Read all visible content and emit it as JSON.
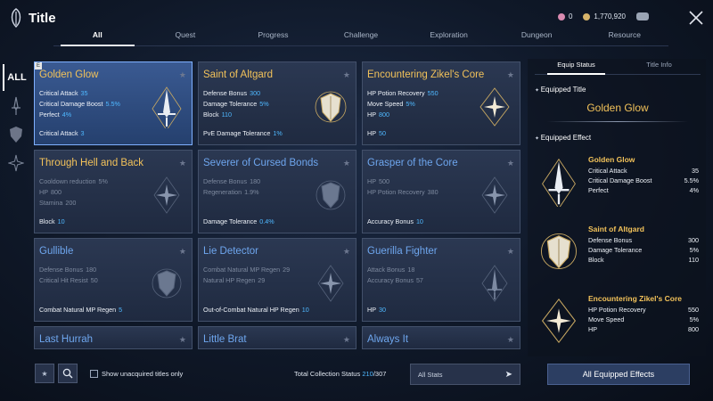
{
  "header": {
    "title": "Title",
    "currency1": "0",
    "currency2": "1,770,920"
  },
  "tabs": [
    "All",
    "Quest",
    "Progress",
    "Challenge",
    "Exploration",
    "Dungeon",
    "Resource"
  ],
  "rail": {
    "all": "ALL"
  },
  "cards": [
    {
      "title": "Golden Glow",
      "color": "gold",
      "selected": true,
      "new": "E",
      "stats": [
        {
          "k": "Critical Attack",
          "v": "35"
        },
        {
          "k": "Critical Damage Boost",
          "v": "5.5%"
        },
        {
          "k": "Perfect",
          "v": "4%"
        }
      ],
      "bottom": {
        "k": "Critical Attack",
        "v": "3"
      }
    },
    {
      "title": "Saint of Altgard",
      "color": "gold",
      "stats": [
        {
          "k": "Defense Bonus",
          "v": "300"
        },
        {
          "k": "Damage Tolerance",
          "v": "5%"
        },
        {
          "k": "Block",
          "v": "110"
        }
      ],
      "bottom": {
        "k": "PvE Damage Tolerance",
        "v": "1%"
      }
    },
    {
      "title": "Encountering Zikel's Core",
      "color": "gold",
      "stats": [
        {
          "k": "HP Potion Recovery",
          "v": "550"
        },
        {
          "k": "Move Speed",
          "v": "5%"
        },
        {
          "k": "HP",
          "v": "800"
        }
      ],
      "bottom": {
        "k": "HP",
        "v": "50"
      }
    },
    {
      "title": "Through Hell and Back",
      "color": "gold",
      "dim": true,
      "stats": [
        {
          "k": "Cooldown reduction",
          "v": "5%"
        },
        {
          "k": "HP",
          "v": "800"
        },
        {
          "k": "Stamina",
          "v": "200"
        }
      ],
      "bottom": {
        "k": "Block",
        "v": "10"
      }
    },
    {
      "title": "Severer of Cursed Bonds",
      "color": "blue",
      "dim": true,
      "stats": [
        {
          "k": "Defense Bonus",
          "v": "180"
        },
        {
          "k": "Regeneration",
          "v": "1.9%"
        }
      ],
      "bottom": {
        "k": "Damage Tolerance",
        "v": "0.4%"
      }
    },
    {
      "title": "Grasper of the Core",
      "color": "blue",
      "dim": true,
      "stats": [
        {
          "k": "HP",
          "v": "500"
        },
        {
          "k": "HP Potion Recovery",
          "v": "380"
        }
      ],
      "bottom": {
        "k": "Accuracy Bonus",
        "v": "10"
      }
    },
    {
      "title": "Gullible",
      "color": "blue",
      "dim": true,
      "stats": [
        {
          "k": "Defense Bonus",
          "v": "180"
        },
        {
          "k": "Critical Hit Resist",
          "v": "50"
        }
      ],
      "bottom": {
        "k": "Combat Natural MP Regen",
        "v": "5"
      }
    },
    {
      "title": "Lie Detector",
      "color": "blue",
      "dim": true,
      "stats": [
        {
          "k": "Combat Natural MP Regen",
          "v": "29"
        },
        {
          "k": "Natural HP Regen",
          "v": "29"
        }
      ],
      "bottom": {
        "k": "Out-of-Combat Natural HP Regen",
        "v": "10"
      }
    },
    {
      "title": "Guerilla Fighter",
      "color": "blue",
      "dim": true,
      "stats": [
        {
          "k": "Attack Bonus",
          "v": "18"
        },
        {
          "k": "Accuracy Bonus",
          "v": "57"
        }
      ],
      "bottom": {
        "k": "HP",
        "v": "30"
      }
    },
    {
      "title": "Last Hurrah",
      "color": "blue",
      "stats": [],
      "bottom": null
    },
    {
      "title": "Little Brat",
      "color": "blue",
      "stats": [],
      "bottom": null
    },
    {
      "title": "Always It",
      "color": "blue",
      "stats": [],
      "bottom": null
    }
  ],
  "bottom": {
    "unacquired": "Show unacquired titles only",
    "total_label": "Total Collection Status",
    "total_have": "210",
    "total_all": "/307",
    "all_stats": "All Stats",
    "all_effects": "All Equipped Effects"
  },
  "panel": {
    "tabs": [
      "Equip Status",
      "Title Info"
    ],
    "equipped_title_h": "Equipped Title",
    "equipped_title": "Golden Glow",
    "equipped_effect_h": "Equipped Effect",
    "effects": [
      {
        "name": "Golden Glow",
        "rows": [
          {
            "k": "Critical Attack",
            "v": "35"
          },
          {
            "k": "Critical Damage Boost",
            "v": "5.5%"
          },
          {
            "k": "Perfect",
            "v": "4%"
          }
        ]
      },
      {
        "name": "Saint of Altgard",
        "rows": [
          {
            "k": "Defense Bonus",
            "v": "300"
          },
          {
            "k": "Damage Tolerance",
            "v": "5%"
          },
          {
            "k": "Block",
            "v": "110"
          }
        ]
      },
      {
        "name": "Encountering Zikel's Core",
        "rows": [
          {
            "k": "HP Potion Recovery",
            "v": "550"
          },
          {
            "k": "Move Speed",
            "v": "5%"
          },
          {
            "k": "HP",
            "v": "800"
          }
        ]
      }
    ]
  }
}
